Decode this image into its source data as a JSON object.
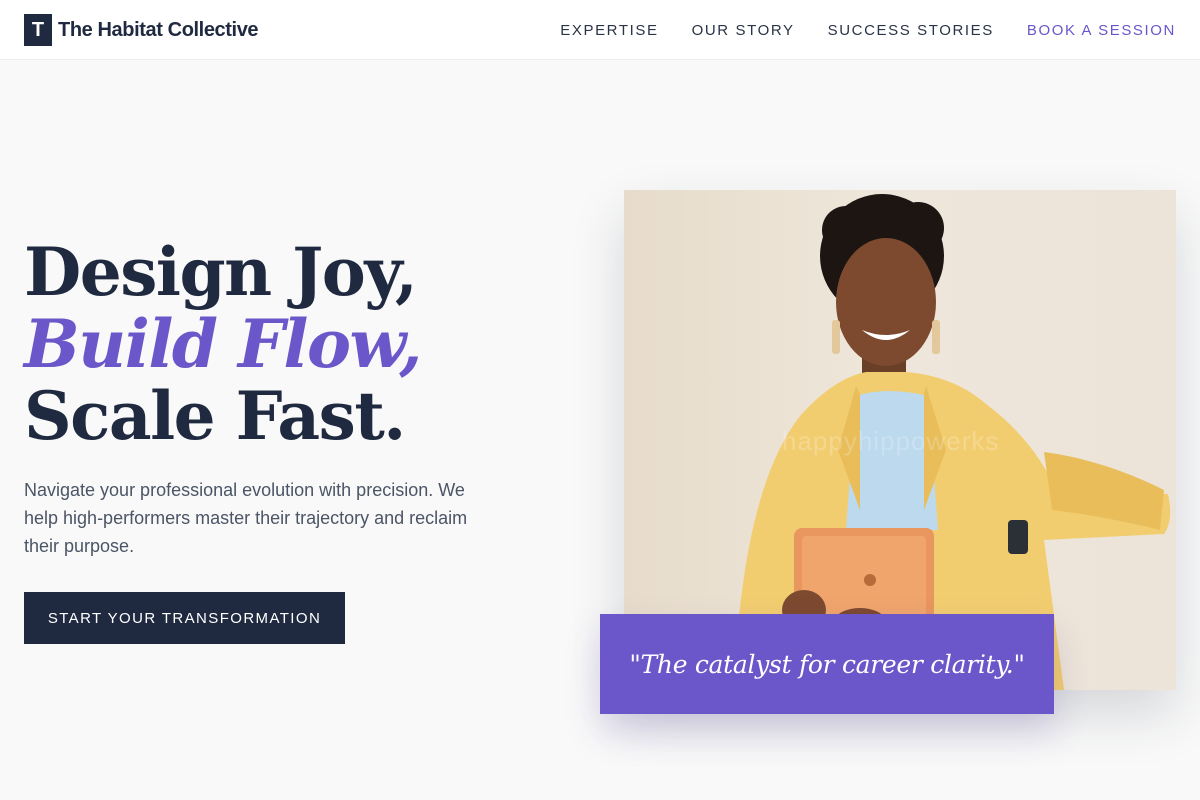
{
  "brand": {
    "mark": "T",
    "name": "The Habitat Collective"
  },
  "nav": {
    "items": [
      "EXPERTISE",
      "OUR STORY",
      "SUCCESS STORIES"
    ],
    "cta": "BOOK A SESSION"
  },
  "hero": {
    "headline": {
      "line1": "Design Joy,",
      "line2": "Build Flow,",
      "line3": "Scale Fast."
    },
    "lede": "Navigate your professional evolution with precision. We help high-performers master their trajectory and reclaim their purpose.",
    "cta": "START YOUR TRANSFORMATION",
    "image_watermark": "happyhippowerks",
    "quote": "\"The catalyst for career clarity.\""
  },
  "colors": {
    "ink": "#1f2a40",
    "accent": "#6b57c9",
    "background": "#f9f9f9",
    "body_text": "#4b5566"
  }
}
